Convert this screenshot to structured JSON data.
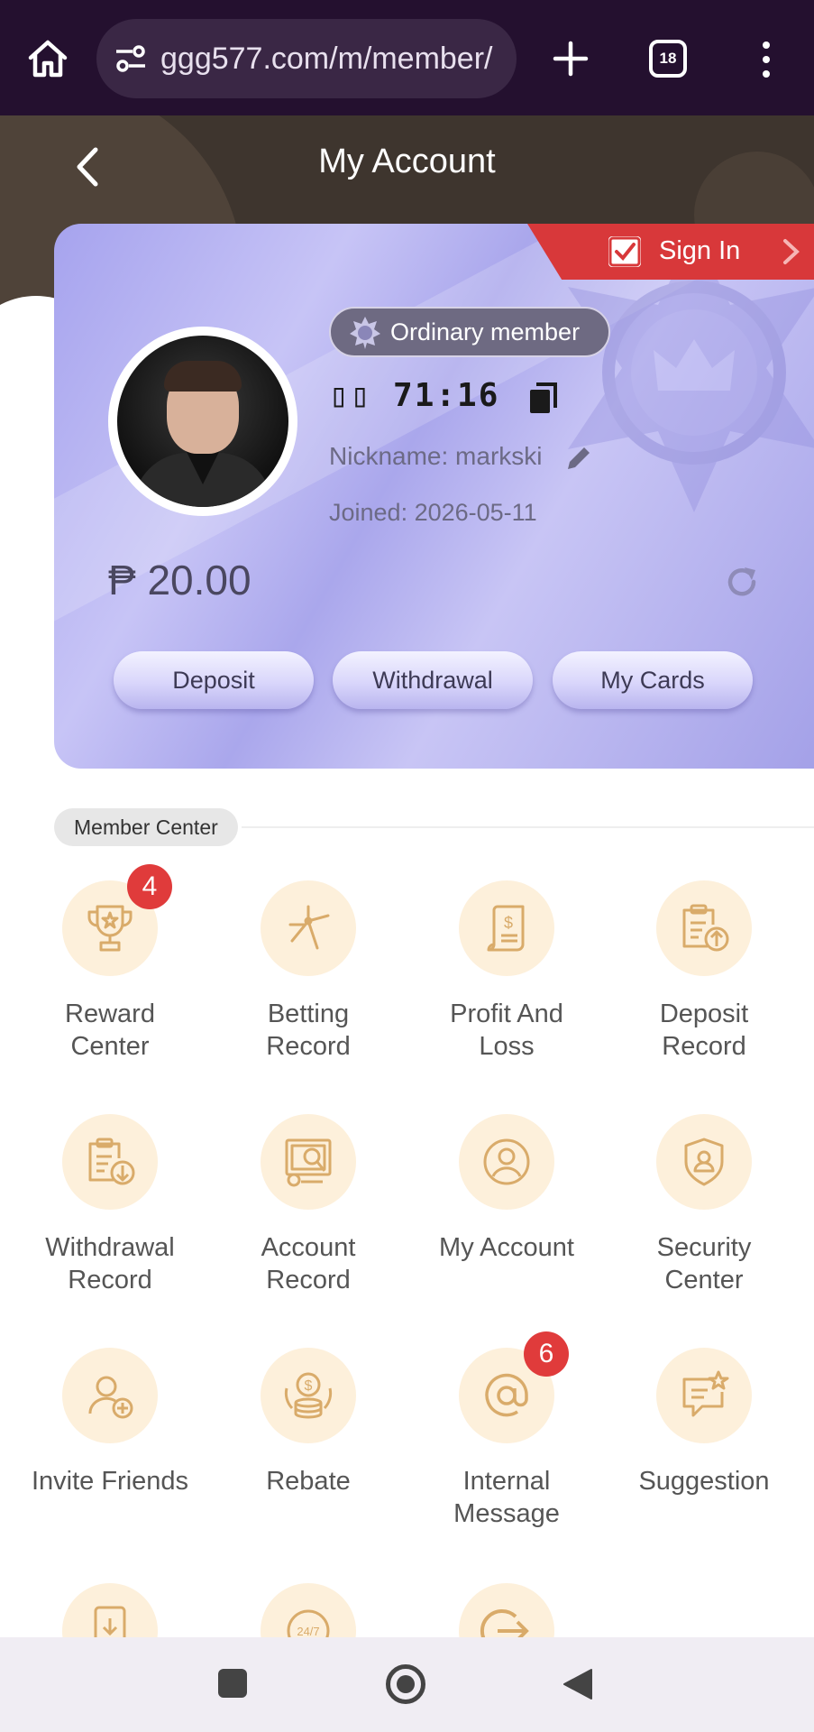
{
  "browser": {
    "url": "ggg577.com/m/member/",
    "tab_count": "18"
  },
  "header": {
    "title": "My Account"
  },
  "card": {
    "signin_label": "Sign In",
    "member_level": "Ordinary member",
    "account_id": "▯▯ 71:16",
    "nickname": "Nickname: markski",
    "joined": "Joined:  2026-05-11",
    "balance": "₱ 20.00",
    "buttons": {
      "deposit": "Deposit",
      "withdrawal": "Withdrawal",
      "my_cards": "My Cards"
    }
  },
  "member_center": {
    "label": "Member Center",
    "items": [
      {
        "label": "Reward\nCenter",
        "icon": "trophy-icon",
        "badge": "4"
      },
      {
        "label": "Betting\nRecord",
        "icon": "stars-icon"
      },
      {
        "label": "Profit And\nLoss",
        "icon": "receipt-dollar-icon"
      },
      {
        "label": "Deposit\nRecord",
        "icon": "clipboard-upload-icon"
      },
      {
        "label": "Withdrawal\nRecord",
        "icon": "clipboard-download-icon"
      },
      {
        "label": "Account\nRecord",
        "icon": "monitor-chart-icon"
      },
      {
        "label": "My Account",
        "icon": "user-circle-icon"
      },
      {
        "label": "Security\nCenter",
        "icon": "shield-user-icon"
      },
      {
        "label": "Invite Friends",
        "icon": "user-add-icon"
      },
      {
        "label": "Rebate",
        "icon": "coins-icon"
      },
      {
        "label": "Internal\nMessage",
        "icon": "at-sign-icon",
        "badge": "6"
      },
      {
        "label": "Suggestion",
        "icon": "chat-star-icon"
      }
    ]
  },
  "colors": {
    "browser_bar": "#24102f",
    "card_gradient": "#a6a3ee",
    "icon_bg": "#fdf0db",
    "icon_stroke": "#d9ab6a",
    "badge": "#e03b3b",
    "signin": "#d8383a"
  }
}
